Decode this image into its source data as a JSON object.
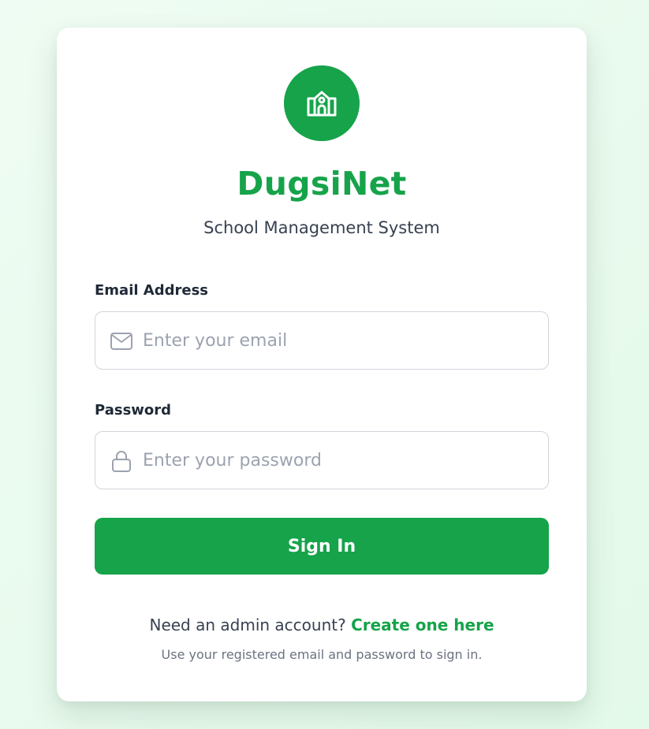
{
  "brand": {
    "title": "DugsiNet",
    "subtitle": "School Management System",
    "logo_icon": "school-icon",
    "accent_color": "#16a34a"
  },
  "form": {
    "email": {
      "label": "Email Address",
      "placeholder": "Enter your email",
      "value": "",
      "icon": "mail-icon"
    },
    "password": {
      "label": "Password",
      "placeholder": "Enter your password",
      "value": "",
      "icon": "lock-icon"
    },
    "submit_label": "Sign In"
  },
  "footer": {
    "register_prompt": "Need an admin account?",
    "register_link": "Create one here",
    "hint": "Use your registered email and password to sign in."
  }
}
